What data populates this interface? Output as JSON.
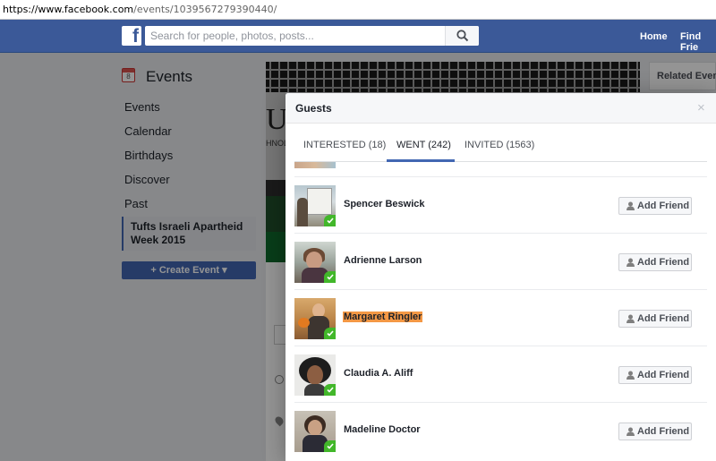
{
  "browser": {
    "url_host": "https://www.facebook.com",
    "url_path": "/events/1039567279390440/"
  },
  "topbar": {
    "logo": "f",
    "search_placeholder": "Search for people, photos, posts...",
    "nav": [
      "Home",
      "Find Frie"
    ]
  },
  "left_nav": {
    "title": "Events",
    "calendar_icon_day": "8",
    "items": [
      "Events",
      "Calendar",
      "Birthdays",
      "Discover",
      "Past"
    ],
    "active_item": "Tufts Israeli Apartheid Week 2015",
    "create_label": "+ Create Event ▾"
  },
  "background": {
    "related_label": "Related Events",
    "cover_letters": "UF",
    "cover_sub": "HNOL"
  },
  "modal": {
    "title": "Guests",
    "close": "×",
    "tabs": [
      {
        "label": "INTERESTED (18)",
        "active": false
      },
      {
        "label": "WENT (242)",
        "active": true
      },
      {
        "label": "INVITED (1563)",
        "active": false
      }
    ],
    "add_friend_label": "Add Friend",
    "guests": [
      {
        "name": "Spencer Beswick",
        "highlighted": false
      },
      {
        "name": "Adrienne Larson",
        "highlighted": false
      },
      {
        "name": "Margaret Ringler",
        "highlighted": true
      },
      {
        "name": "Claudia A. Aliff",
        "highlighted": false
      },
      {
        "name": "Madeline Doctor",
        "highlighted": false
      }
    ]
  },
  "colors": {
    "brand": "#3b5998",
    "accent": "#4267b2",
    "went_check": "#42b72a",
    "highlight": "#f49845"
  }
}
